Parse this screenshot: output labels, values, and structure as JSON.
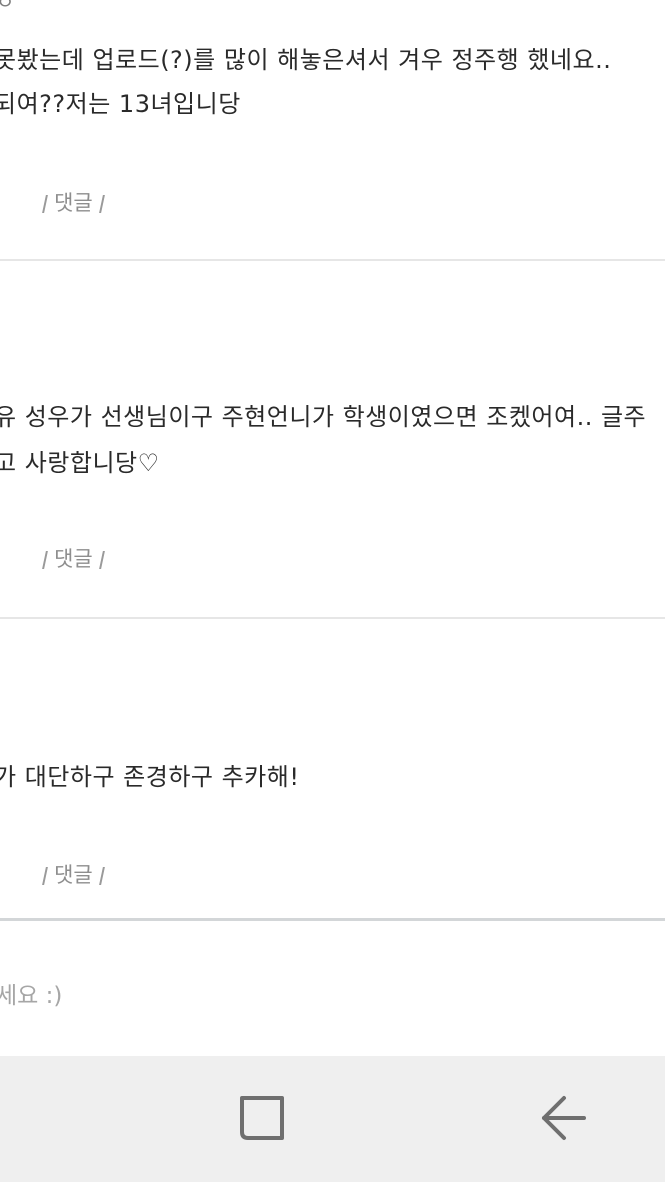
{
  "top_fragment": "ㅇ",
  "comments": [
    {
      "lines": [
        "못봤는데 업로드(?)를 많이 해놓은셔서 겨우 정주행 했네요..",
        "되여??저는 13녀입니당"
      ],
      "reply_label": "댓글",
      "date": ""
    },
    {
      "lines": [
        "유 성우가 선생님이구 주현언니가 학생이였으면 조켔어여.. 글주",
        "고 사랑합니당♡"
      ],
      "reply_label": "댓글",
      "date": "·"
    },
    {
      "lines": [
        "가 대단하구 존경하구 추카해!"
      ],
      "reply_label": "댓글",
      "date": "·"
    }
  ],
  "comment_input": {
    "placeholder": "세요 :)"
  },
  "navbar": {
    "icons": [
      "recent-apps-icon",
      "back-icon"
    ]
  }
}
